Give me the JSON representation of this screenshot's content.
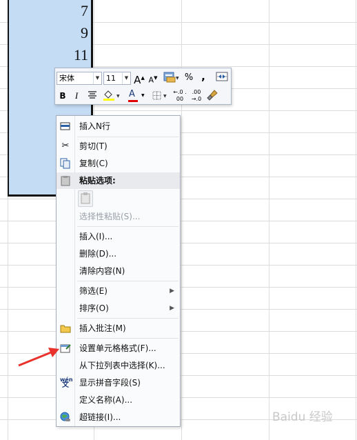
{
  "cells": [
    "7",
    "9",
    "11"
  ],
  "mini_toolbar": {
    "font_name": "宋体",
    "font_size": "11",
    "grow_font": "A",
    "shrink_font": "A",
    "percent": "%",
    "comma": ",",
    "bold": "B",
    "italic": "I",
    "font_color_glyph": "A",
    "increase_decimal": "←.0 .00",
    "decrease_decimal": ".00 →.0"
  },
  "menu": {
    "insert_n_rows": "插入N行",
    "cut": "剪切(T)",
    "copy": "复制(C)",
    "paste_options": "粘贴选项:",
    "paste_special": "选择性粘贴(S)...",
    "insert": "插入(I)...",
    "delete": "删除(D)...",
    "clear_contents": "清除内容(N)",
    "filter": "筛选(E)",
    "sort": "排序(O)",
    "insert_comment": "插入批注(M)",
    "format_cells": "设置单元格格式(F)...",
    "pick_from_list": "从下拉列表中选择(K)...",
    "show_phonetic": "显示拼音字段(S)",
    "define_name": "定义名称(A)...",
    "hyperlink": "超链接(I)..."
  },
  "colors": {
    "highlight": "#ffff00",
    "font_color": "#e00000",
    "selection": "#c5dcf5",
    "annotation_arrow": "#e8322b"
  },
  "watermark": "Baidu 经验"
}
